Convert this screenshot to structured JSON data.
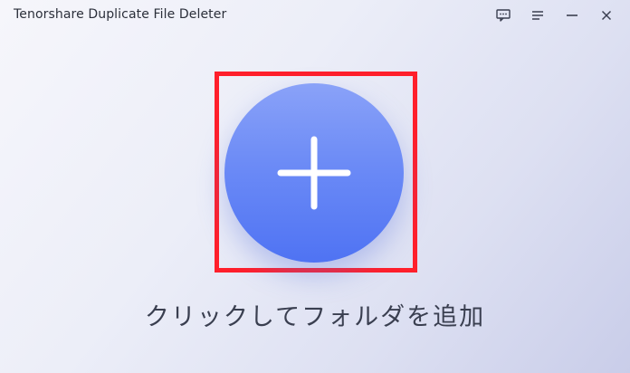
{
  "window": {
    "title": "Tenorshare Duplicate File Deleter"
  },
  "controls": [
    {
      "name": "feedback-icon"
    },
    {
      "name": "menu-icon"
    },
    {
      "name": "minimize-icon"
    },
    {
      "name": "close-icon"
    }
  ],
  "main": {
    "add_icon": "plus-icon",
    "prompt": "クリックしてフォルダを追加"
  },
  "colors": {
    "highlight": "#ff1f2b",
    "button_top": "#8aa2f8",
    "button_bottom": "#4f73f3",
    "text": "#3a3f50"
  }
}
